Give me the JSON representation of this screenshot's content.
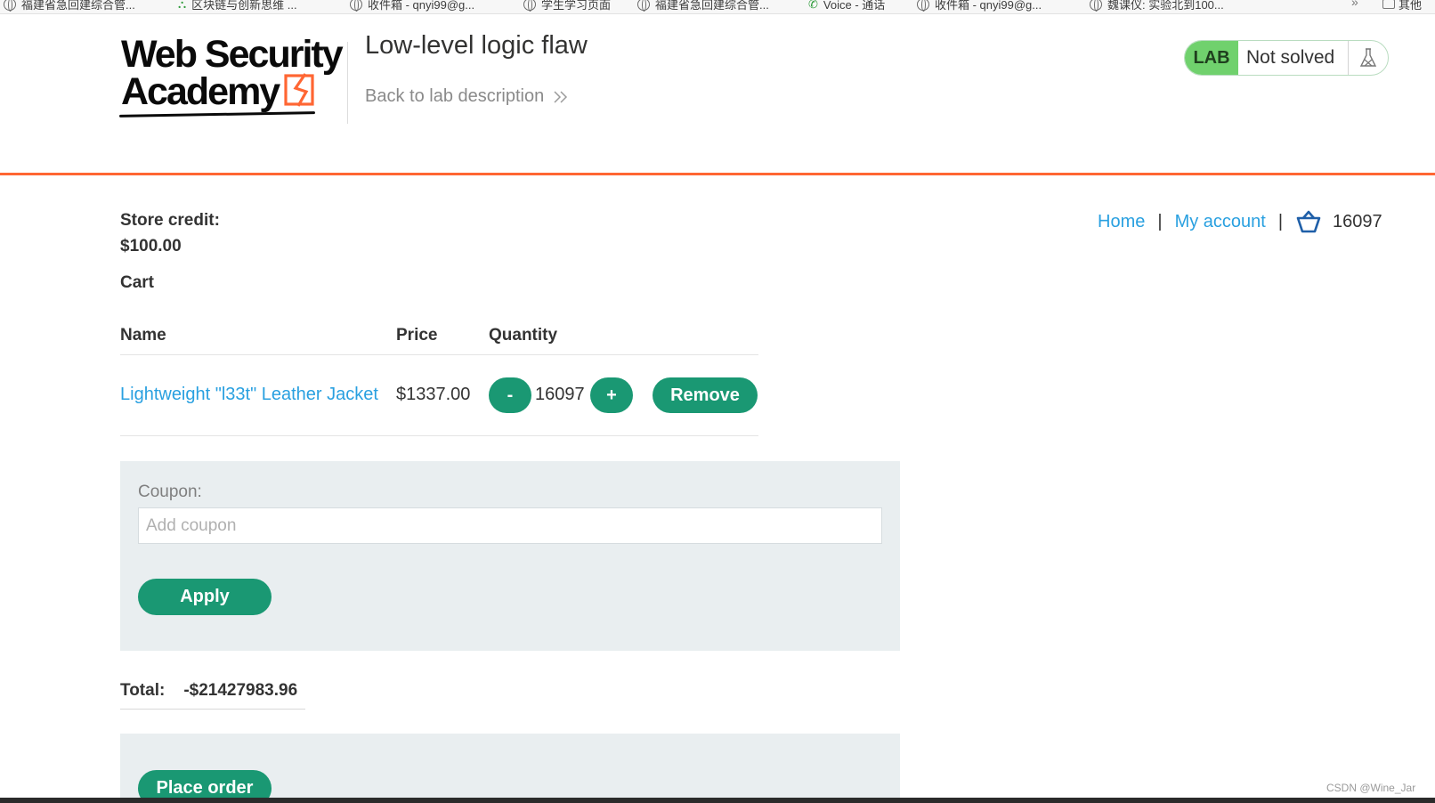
{
  "bookmarks_bar": {
    "items": [
      {
        "label": "福建省急回建综合管...",
        "icon": "globe-icon"
      },
      {
        "label": "区块链与创新思维 ...",
        "icon": "path-icon"
      },
      {
        "label": "收件箱 - qnyi99@g...",
        "icon": "globe-icon"
      },
      {
        "label": "学生学习页面",
        "icon": "globe-icon"
      },
      {
        "label": "福建省急回建综合管...",
        "icon": "globe-icon"
      },
      {
        "label": "Voice - 通话",
        "icon": "phone-icon"
      },
      {
        "label": "收件箱 - qnyi99@g...",
        "icon": "globe-icon"
      },
      {
        "label": "魏课仪: 实验北到100...",
        "icon": "globe-icon"
      }
    ],
    "overflow": "»",
    "other_label": "其他"
  },
  "header": {
    "logo_line1": "Web Security",
    "logo_line2": "Academy",
    "lab_title": "Low-level logic flaw",
    "back_link": "Back to lab description",
    "lab_badge": "LAB",
    "lab_status": "Not solved"
  },
  "account": {
    "store_credit_label": "Store credit:",
    "store_credit_value": "$100.00",
    "cart_heading": "Cart"
  },
  "nav": {
    "home": "Home",
    "separator": "|",
    "my_account": "My account",
    "cart_count": "16097"
  },
  "cart_table": {
    "headers": {
      "name": "Name",
      "price": "Price",
      "quantity": "Quantity"
    },
    "rows": [
      {
        "name": "Lightweight \"l33t\" Leather Jacket",
        "price": "$1337.00",
        "quantity": "16097"
      }
    ],
    "minus_label": "-",
    "plus_label": "+",
    "remove_label": "Remove"
  },
  "coupon": {
    "label": "Coupon:",
    "placeholder": "Add coupon",
    "value": "",
    "apply_label": "Apply"
  },
  "total": {
    "label": "Total:",
    "value": "-$21427983.96"
  },
  "order": {
    "place_order_label": "Place order"
  },
  "watermark": "CSDN @Wine_Jar",
  "colors": {
    "accent_orange": "#ff6633",
    "button_green": "#1a9873",
    "link_blue": "#29a0e0",
    "lab_badge_green": "#70d16d",
    "panel_grey": "#e9eef0"
  }
}
